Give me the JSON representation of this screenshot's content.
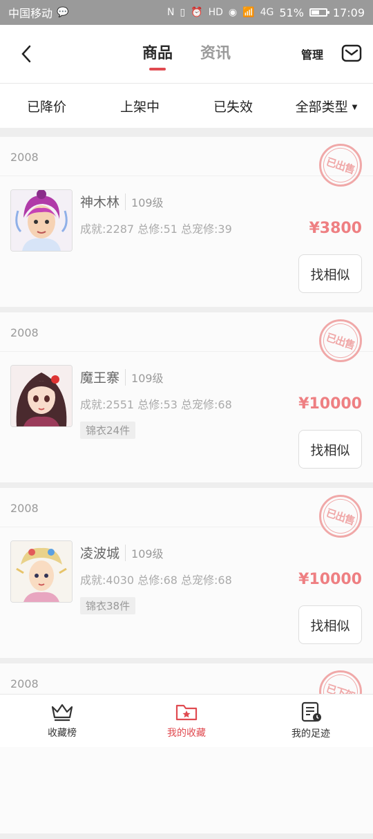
{
  "status_bar": {
    "carrier": "中国移动",
    "battery": "51%",
    "time": "17:09",
    "network": "4G"
  },
  "nav": {
    "tabs": [
      "商品",
      "资讯"
    ],
    "active_tab": 0,
    "manage_label": "管理"
  },
  "filters": [
    "已降价",
    "上架中",
    "已失效",
    "全部类型"
  ],
  "items": [
    {
      "year": "2008",
      "stamp": "已出售",
      "name": "神木林",
      "level": "109级",
      "stats": "成就:2287 总修:51 总宠修:39",
      "badge": "",
      "price": "¥3800",
      "similar_label": "找相似"
    },
    {
      "year": "2008",
      "stamp": "已出售",
      "name": "魔王寨",
      "level": "109级",
      "stats": "成就:2551 总修:53 总宠修:68",
      "badge": "锦衣24件",
      "price": "¥10000",
      "similar_label": "找相似"
    },
    {
      "year": "2008",
      "stamp": "已出售",
      "name": "凌波城",
      "level": "109级",
      "stats": "成就:4030 总修:68 总宠修:68",
      "badge": "锦衣38件",
      "price": "¥10000",
      "similar_label": "找相似"
    },
    {
      "year": "2008",
      "stamp": "已下架"
    }
  ],
  "bottom_nav": {
    "items": [
      "收藏榜",
      "我的收藏",
      "我的足迹"
    ],
    "active": 1
  },
  "colors": {
    "accent": "#e04a50",
    "price": "#ee7f82",
    "stamp": "#f0a8a8"
  }
}
